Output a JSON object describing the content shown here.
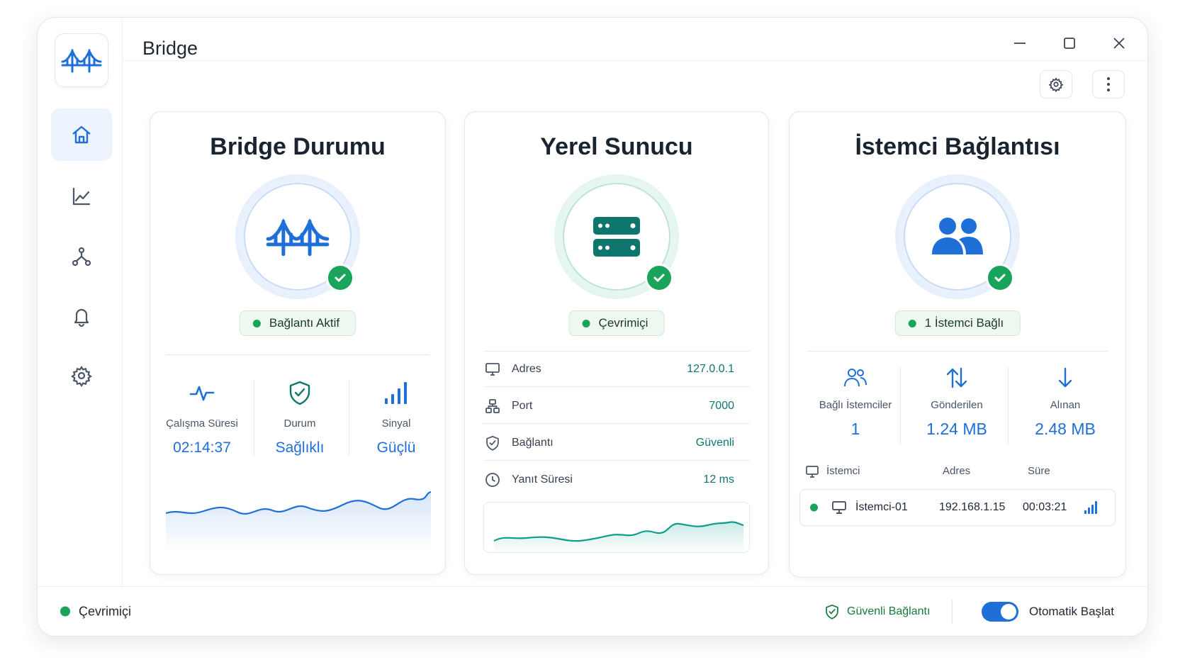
{
  "app": {
    "title": "Bridge"
  },
  "colors": {
    "accent": "#1f6fd9",
    "success": "#1aa35a",
    "teal": "#0f766e",
    "border": "#e3e7ee"
  },
  "sidebar": {
    "items": [
      {
        "id": "home",
        "icon": "home-icon",
        "active": true
      },
      {
        "id": "stats",
        "icon": "chart-line-icon",
        "active": false
      },
      {
        "id": "network",
        "icon": "network-nodes-icon",
        "active": false
      },
      {
        "id": "notifications",
        "icon": "bell-icon",
        "active": false
      },
      {
        "id": "settings",
        "icon": "gear-icon",
        "active": false
      }
    ]
  },
  "bridge_card": {
    "title": "Bridge Durumu",
    "status": "Bağlantı Aktif",
    "stats": [
      {
        "icon": "pulse-icon",
        "label": "Çalışma Süresi",
        "value": "02:14:37"
      },
      {
        "icon": "shield-check-icon",
        "label": "Durum",
        "value": "Sağlıklı"
      },
      {
        "icon": "signal-bars-icon",
        "label": "Sinyal",
        "value": "Güçlü"
      }
    ]
  },
  "server_card": {
    "title": "Yerel Sunucu",
    "status": "Çevrimiçi",
    "rows": [
      {
        "icon": "monitor-icon",
        "label": "Adres",
        "value": "127.0.0.1"
      },
      {
        "icon": "network-icon",
        "label": "Port",
        "value": "7000"
      },
      {
        "icon": "shield-check-icon",
        "label": "Bağlantı",
        "value": "Güvenli"
      },
      {
        "icon": "clock-icon",
        "label": "Yanıt Süresi",
        "value": "12 ms"
      }
    ]
  },
  "client_card": {
    "title": "İstemci Bağlantısı",
    "status": "1 İstemci Bağlı",
    "stats": [
      {
        "icon": "users-icon",
        "label": "Bağlı İstemciler",
        "value": "1"
      },
      {
        "icon": "arrows-up-down-icon",
        "label": "Gönderilen",
        "value": "1.24 MB"
      },
      {
        "icon": "arrow-down-icon",
        "label": "Alınan",
        "value": "2.48 MB"
      }
    ],
    "table": {
      "headers": {
        "client": "İstemci",
        "address": "Adres",
        "duration": "Süre"
      },
      "rows": [
        {
          "name": "İstemci-01",
          "address": "192.168.1.15",
          "duration": "00:03:21"
        }
      ]
    }
  },
  "statusbar": {
    "online": "Çevrimiçi",
    "secure": "Güvenli Bağlantı",
    "autostart_label": "Otomatik Başlat",
    "autostart_on": true
  }
}
